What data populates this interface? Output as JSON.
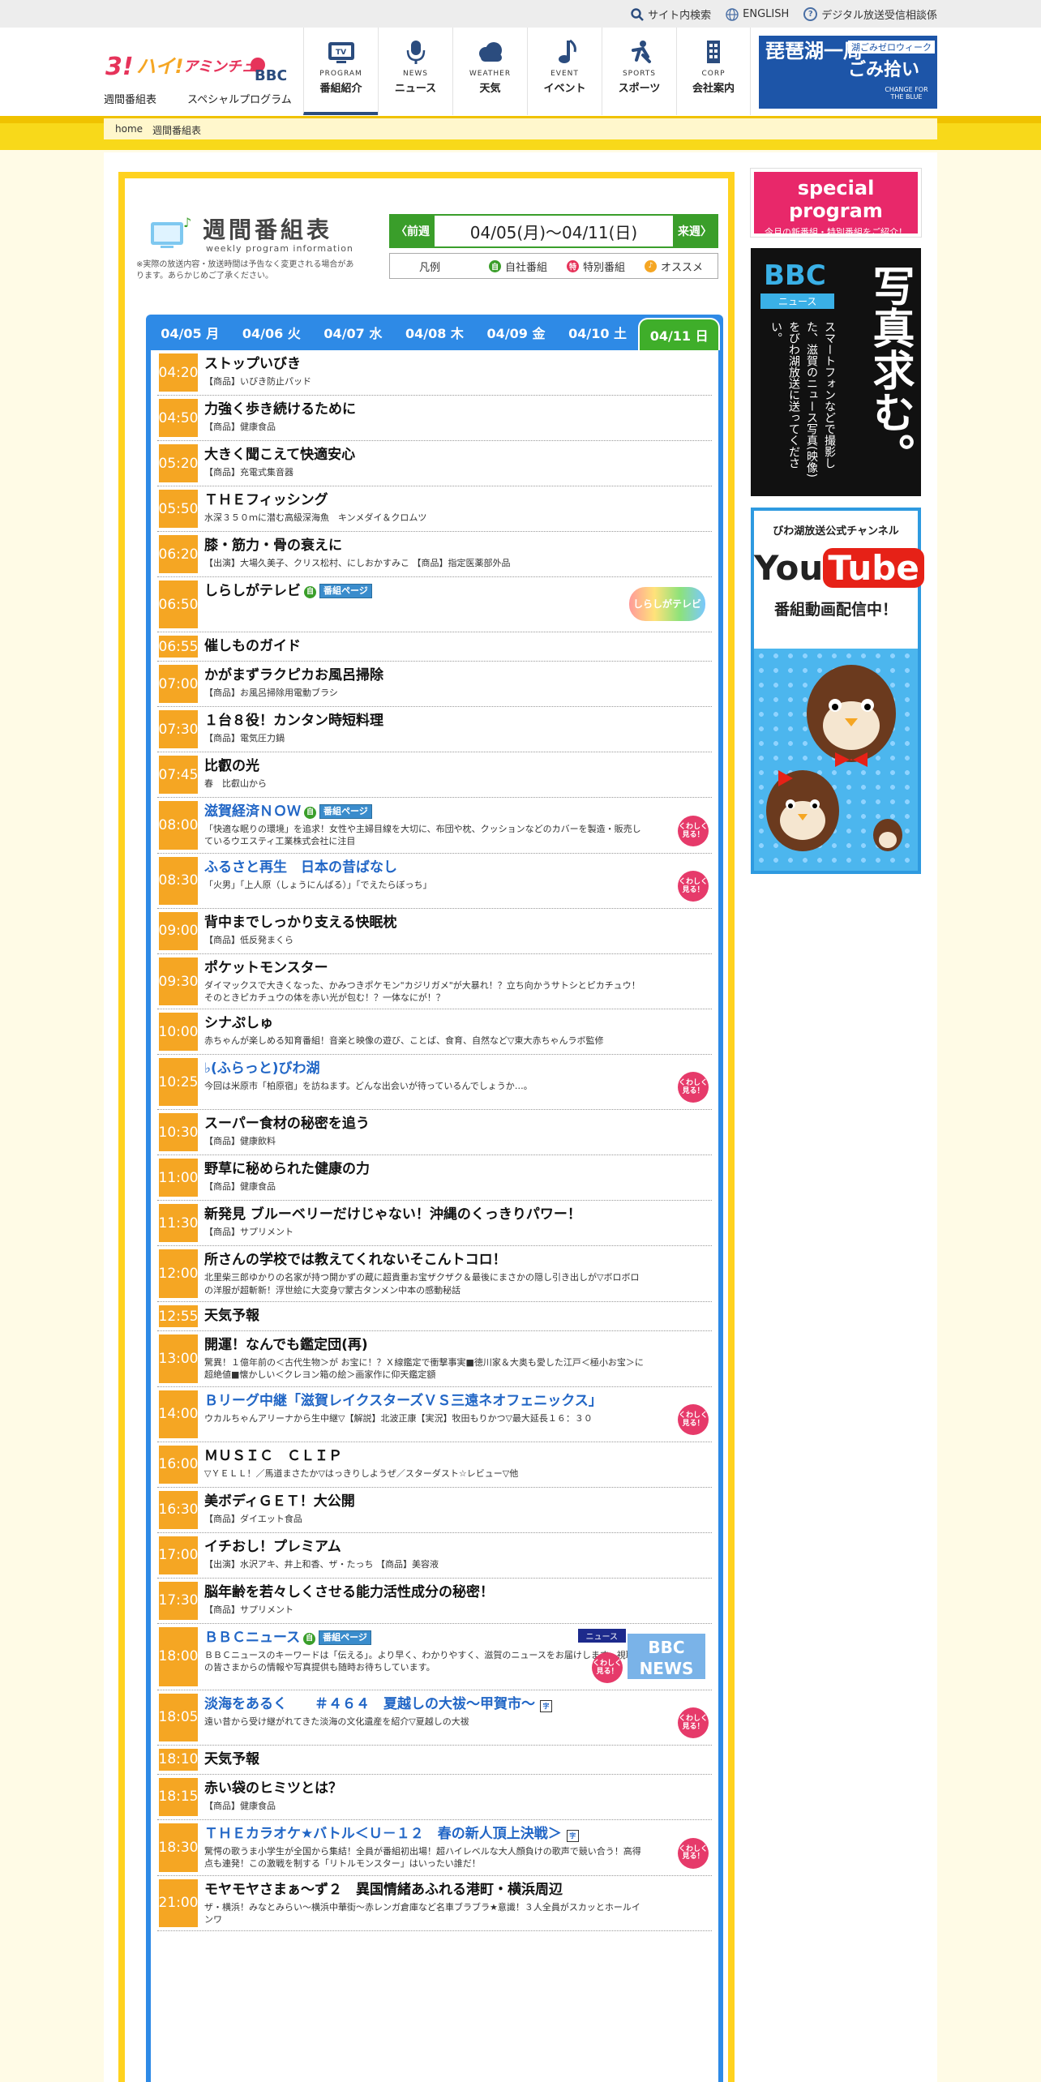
{
  "util": {
    "search": "サイト内検索",
    "english": "ENGLISH",
    "digital": "デジタル放送受信相談係"
  },
  "header": {
    "logo_text": "3!ハイ!アミンチュ BBC",
    "sub_links": [
      "週間番組表",
      "スペシャルプログラム"
    ],
    "nav": [
      {
        "en": "PROGRAM",
        "jp": "番組紹介",
        "icon": "tv-icon"
      },
      {
        "en": "NEWS",
        "jp": "ニュース",
        "icon": "microphone-icon"
      },
      {
        "en": "WEATHER",
        "jp": "天気",
        "icon": "cloud-icon"
      },
      {
        "en": "EVENT",
        "jp": "イベント",
        "icon": "music-note-icon"
      },
      {
        "en": "SPORTS",
        "jp": "スポーツ",
        "icon": "sports-icon"
      },
      {
        "en": "CORP",
        "jp": "会社案内",
        "icon": "building-icon"
      }
    ],
    "banner": {
      "line1": "琵琶湖一周",
      "line2": "湖ごみゼロウィーク",
      "line3": "ごみ拾い",
      "line4": "CHANGE FOR THE BLUE"
    }
  },
  "breadcrumb": [
    "home",
    "週間番組表"
  ],
  "schedule": {
    "title": "週間番組表",
    "title_en": "weekly program information",
    "note": "※実際の放送内容・放送時間は予告なく変更される場合があります。あらかじめご了承ください。",
    "prev": "前週",
    "next": "来週",
    "range": "04/05(月)～04/11(日)",
    "legend_label": "凡例",
    "legend": [
      {
        "mark": "自",
        "label": "自社番組",
        "color": "#3a9e2a"
      },
      {
        "mark": "特",
        "label": "特別番組",
        "color": "#e6335a"
      },
      {
        "mark": "♪",
        "label": "オススメ",
        "color": "#f5a623"
      }
    ],
    "tabs": [
      "04/05 月",
      "04/06 火",
      "04/07 水",
      "04/08 木",
      "04/09 金",
      "04/10 土",
      "04/11 日"
    ],
    "active_tab": 6,
    "own_badge": "自",
    "page_badge": "番組ページ",
    "more_label_1": "くわしく",
    "more_label_2": "見る！",
    "cap_badge": "字",
    "news_tag": "ニュース",
    "news_pic": "BBC NEWS",
    "shirashiga_pic": "しらしがテレビ",
    "programs": [
      {
        "time": "04:20",
        "title": "ストップいびき",
        "sub": "【商品】いびき防止パッド"
      },
      {
        "time": "04:50",
        "title": "力強く歩き続けるために",
        "sub": "【商品】健康食品"
      },
      {
        "time": "05:20",
        "title": "大きく聞こえて快適安心",
        "sub": "【商品】充電式集音器"
      },
      {
        "time": "05:50",
        "title": "ＴＨＥフィッシング",
        "sub": "水深３５０ｍに潜む高級深海魚　キンメダイ＆クロムツ"
      },
      {
        "time": "06:20",
        "title": "膝・筋力・骨の衰えに",
        "sub": "【出演】大場久美子、クリス松村、にしおかすみこ 【商品】指定医薬部外品"
      },
      {
        "time": "06:50",
        "title": "しらしがテレビ",
        "sub": "",
        "own": true,
        "page": true,
        "pic": "shirashiga"
      },
      {
        "time": "06:55",
        "title": "催しものガイド",
        "sub": ""
      },
      {
        "time": "07:00",
        "title": "かがまずラクピカお風呂掃除",
        "sub": "【商品】お風呂掃除用電動ブラシ"
      },
      {
        "time": "07:30",
        "title": "１台８役！カンタン時短料理",
        "sub": "【商品】電気圧力鍋"
      },
      {
        "time": "07:45",
        "title": "比叡の光",
        "sub": "春　比叡山から"
      },
      {
        "time": "08:00",
        "title": "滋賀経済ＮＯＷ",
        "sub": "「快適な眠りの環境」を追求！女性や主婦目線を大切に、布団や枕、クッションなどのカバーを製造・販売しているウエスティ工業株式会社に注目",
        "own": true,
        "page": true,
        "link": true,
        "more": true
      },
      {
        "time": "08:30",
        "title": "ふるさと再生　日本の昔ばなし",
        "sub": "「火男」「上人原（しょうにんばる）」「でえたらぼっち」",
        "link": true,
        "more": true
      },
      {
        "time": "09:00",
        "title": "背中までしっかり支える快眠枕",
        "sub": "【商品】低反発まくら"
      },
      {
        "time": "09:30",
        "title": "ポケットモンスター",
        "sub": "ダイマックスで大きくなった、かみつきポケモン\"カジリガメ\"が大暴れ！？立ち向かうサトシとピカチュウ！そのときピカチュウの体を赤い光が包む！？一体なにが！？"
      },
      {
        "time": "10:00",
        "title": "シナぷしゅ",
        "sub": "赤ちゃんが楽しめる知育番組！音楽と映像の遊び、ことば、食育、自然など▽東大赤ちゃんラボ監修"
      },
      {
        "time": "10:25",
        "title": "♭(ふらっと)びわ湖",
        "sub": "今回は米原市「柏原宿」を訪ねます。どんな出会いが待っているんでしょうか…。",
        "link": true,
        "more": true
      },
      {
        "time": "10:30",
        "title": "スーパー食材の秘密を追う",
        "sub": "【商品】健康飲料"
      },
      {
        "time": "11:00",
        "title": "野草に秘められた健康の力",
        "sub": "【商品】健康食品"
      },
      {
        "time": "11:30",
        "title": "新発見 ブルーベリーだけじゃない！沖縄のくっきりパワー！",
        "sub": "【商品】サプリメント"
      },
      {
        "time": "12:00",
        "title": "所さんの学校では教えてくれないそこんトコロ！",
        "sub": "北里柴三郎ゆかりの名家が持つ開かずの蔵に超貴重お宝ザクザク＆最後にまさかの隠し引き出しが▽ボロボロの洋服が超斬新！浮世絵に大変身▽蒙古タンメン中本の感動秘話"
      },
      {
        "time": "12:55",
        "title": "天気予報",
        "sub": ""
      },
      {
        "time": "13:00",
        "title": "開運！なんでも鑑定団(再)",
        "sub": "驚異！１億年前の＜古代生物＞が お宝に！？Ｘ線鑑定で衝撃事実■徳川家＆大奥も愛した江戸＜極小お宝＞に超絶値■懐かしい＜クレヨン箱の絵＞画家作に仰天鑑定額"
      },
      {
        "time": "14:00",
        "title": "Ｂリーグ中継「滋賀レイクスターズＶＳ三遠ネオフェニックス」",
        "sub": "ウカルちゃんアリーナから生中継▽【解説】北波正康【実況】牧田もりかつ▽最大延長１６：３０",
        "link": true,
        "more": true
      },
      {
        "time": "16:00",
        "title": "ＭＵＳＩＣ　ＣＬＩＰ",
        "sub": "▽ＹＥＬＬ！／馬道まさたか▽はっきりしようぜ／スターダスト☆レビュー▽他"
      },
      {
        "time": "16:30",
        "title": "美ボディＧＥＴ！大公開",
        "sub": "【商品】ダイエット食品"
      },
      {
        "time": "17:00",
        "title": "イチおし！プレミアム",
        "sub": "【出演】水沢アキ、井上和香、ザ・たっち 【商品】美容液"
      },
      {
        "time": "17:30",
        "title": "脳年齢を若々しくさせる能力活性成分の秘密！",
        "sub": "【商品】サプリメント"
      },
      {
        "time": "18:00",
        "title": "ＢＢＣニュース",
        "sub": "ＢＢＣニュースのキーワードは「伝える」。より早く、わかりやすく、滋賀のニュースをお届けします。視聴者の皆さまからの情報や写真提供も随時お待ちしています。",
        "own": true,
        "page": true,
        "link": true,
        "more": true,
        "pic": "news"
      },
      {
        "time": "18:05",
        "title": "淡海をあるく　　＃４６４　夏越しの大祓～甲賀市～",
        "sub": "遠い昔から受け継がれてきた淡海の文化遺産を紹介▽夏越しの大祓",
        "link": true,
        "more": true,
        "cap": true
      },
      {
        "time": "18:10",
        "title": "天気予報",
        "sub": ""
      },
      {
        "time": "18:15",
        "title": "赤い袋のヒミツとは？",
        "sub": "【商品】健康食品"
      },
      {
        "time": "18:30",
        "title": "ＴＨＥカラオケ★バトル＜Ｕ－１２　春の新人頂上決戦＞",
        "sub": "驚愕の歌うま小学生が全国から集結！全員が番組初出場！超ハイレベルな大人顔負けの歌声で競い合う！高得点も連発！この激戦を制する「リトルモンスター」はいったい誰だ！",
        "link": true,
        "more": true,
        "cap": true
      },
      {
        "time": "21:00",
        "title": "モヤモヤさまぁ～ず２　異国情緒あふれる港町・横浜周辺",
        "sub": "ザ・横浜！みなとみらい～横浜中華街～赤レンガ倉庫など名車ブラブラ★意識！３人全員がスカッとホールインワ"
      }
    ]
  },
  "sidebar": {
    "special_1": "special",
    "special_2": "program",
    "special_3": "今月の新番組・特別番組をご紹介！",
    "bbc_news": "BBC ニュース",
    "bbc_news_sub": "ニュース",
    "photo_big": "写真求む。",
    "photo_text": "スマートフォンなどで撮影した、滋賀のニュース写真(映像)をびわ湖放送に送ってください。",
    "yt_title": "びわ湖放送公式チャンネル",
    "yt_logo_1": "You",
    "yt_logo_2": "Tube",
    "yt_sub": "番組動画配信中！"
  }
}
